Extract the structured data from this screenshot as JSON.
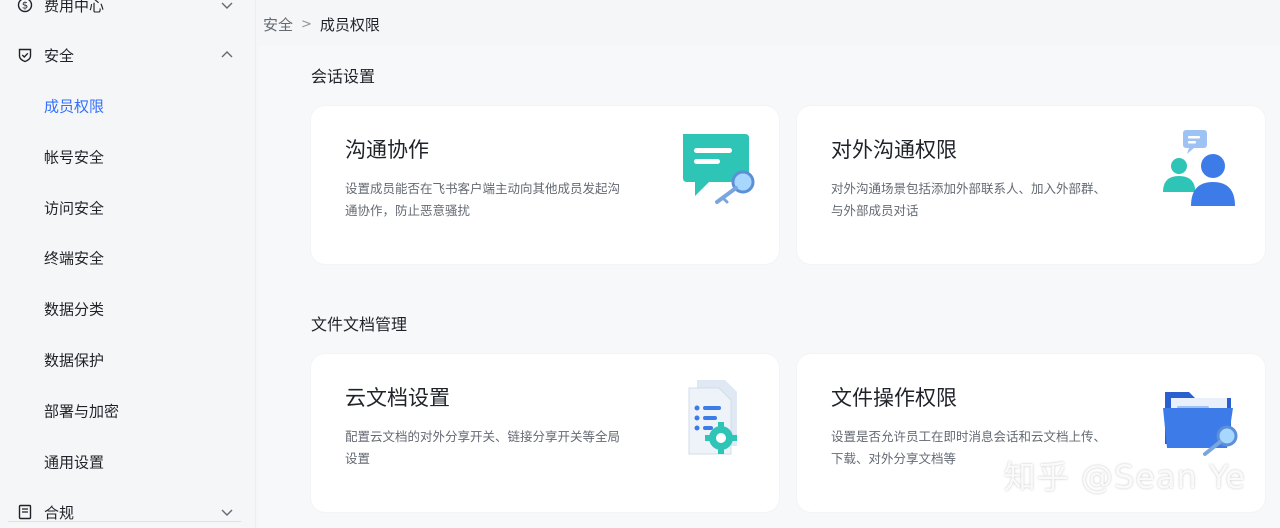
{
  "sidebar": {
    "billing": {
      "label": "费用中心",
      "icon": "dollar-circle-icon"
    },
    "security": {
      "label": "安全",
      "icon": "shield-icon"
    },
    "security_items": [
      {
        "label": "成员权限"
      },
      {
        "label": "帐号安全"
      },
      {
        "label": "访问安全"
      },
      {
        "label": "终端安全"
      },
      {
        "label": "数据分类"
      },
      {
        "label": "数据保护"
      },
      {
        "label": "部署与加密"
      },
      {
        "label": "通用设置"
      }
    ],
    "compliance": {
      "label": "合规",
      "icon": "document-icon"
    }
  },
  "breadcrumb": {
    "parent": "安全",
    "separator": ">",
    "current": "成员权限"
  },
  "sections": [
    {
      "title": "会话设置",
      "cards": [
        {
          "title": "沟通协作",
          "desc": "设置成员能否在飞书客户端主动向其他成员发起沟通协作，防止恶意骚扰",
          "icon": "chat-key-icon"
        },
        {
          "title": "对外沟通权限",
          "desc": "对外沟通场景包括添加外部联系人、加入外部群、与外部成员对话",
          "icon": "users-chat-icon"
        }
      ]
    },
    {
      "title": "文件文档管理",
      "cards": [
        {
          "title": "云文档设置",
          "desc": "配置云文档的对外分享开关、链接分享开关等全局设置",
          "icon": "doc-gear-icon"
        },
        {
          "title": "文件操作权限",
          "desc": "设置是否允许员工在即时消息会话和云文档上传、下载、对外分享文档等",
          "icon": "folder-key-icon"
        }
      ]
    }
  ],
  "watermark": "知乎 @Sean Ye",
  "colors": {
    "accent": "#3370ff",
    "teal": "#2ec4b6",
    "text": "#1f2329",
    "muted": "#646a73"
  }
}
